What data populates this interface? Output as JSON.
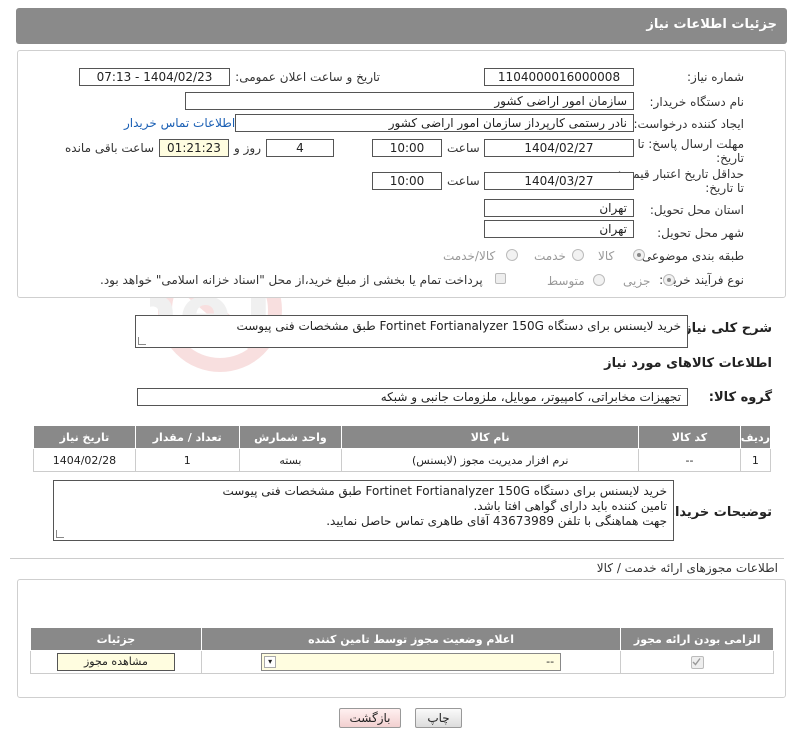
{
  "header": {
    "title": "جزئیات اطلاعات نیاز"
  },
  "form": {
    "need_number_label": "شماره نیاز:",
    "need_number": "1104000016000008",
    "announce_label": "تاریخ و ساعت اعلان عمومی:",
    "announce_value": "1404/02/23 - 07:13",
    "buyer_org_label": "نام دستگاه خریدار:",
    "buyer_org": "سازمان امور اراضی کشور",
    "creator_label": "ایجاد کننده درخواست:",
    "creator": "نادر رستمی کارپرداز سازمان امور اراضی کشور",
    "contact_link": "اطلاعات تماس خریدار",
    "deadline_label_1": "مهلت ارسال پاسخ: تا",
    "deadline_label_2": "تاریخ:",
    "deadline_date": "1404/02/27",
    "time_label": "ساعت",
    "deadline_time": "10:00",
    "days_value": "4",
    "days_label": "روز و",
    "remaining_time": "01:21:23",
    "remaining_label": "ساعت باقی مانده",
    "price_validity_label_1": "حداقل تاریخ اعتبار قیمت:",
    "price_validity_label_2": "تا تاریخ:",
    "price_validity_date": "1404/03/27",
    "price_validity_time": "10:00",
    "province_label": "استان محل تحویل:",
    "province": "تهران",
    "city_label": "شهر محل تحویل:",
    "city": "تهران",
    "category_label": "طبقه بندی موضوعی:",
    "category_options": [
      "کالا",
      "خدمت",
      "کالا/خدمت"
    ],
    "process_label": "نوع فرآیند خرید :",
    "process_options": [
      "جزیی",
      "متوسط"
    ],
    "payment_note": "پرداخت تمام یا بخشی از مبلغ خرید،از محل \"اسناد خزانه اسلامی\" خواهد بود."
  },
  "description": {
    "label": "شرح کلی نیاز:",
    "text": "خرید لایسنس برای دستگاه Fortinet Fortianalyzer 150G طبق مشخصات فنی پیوست"
  },
  "goods": {
    "section_title": "اطلاعات کالاهای مورد نیاز",
    "group_label": "گروه کالا:",
    "group_value": "تجهیزات مخابراتی، کامپیوتر، موبایل، ملزومات جانبی و شبکه",
    "columns": [
      "ردیف",
      "کد کالا",
      "نام کالا",
      "واحد شمارش",
      "تعداد / مقدار",
      "تاریخ نیاز"
    ],
    "rows": [
      [
        "1",
        "--",
        "نرم افزار مدیریت مجوز (لایسنس)",
        "بسته",
        "1",
        "1404/02/28"
      ]
    ]
  },
  "buyer_notes": {
    "label": "توضیحات خریدار:",
    "lines": [
      "خرید لایسنس برای دستگاه Fortinet Fortianalyzer 150G طبق مشخصات فنی پیوست",
      "تامین کننده باید دارای گواهی افتا باشد.",
      "جهت هماهنگی با تلفن 43673989 آقای طاهری تماس حاصل نمایید."
    ]
  },
  "permits": {
    "section_title": "اطلاعات مجوزهای ارائه خدمت / کالا",
    "columns": [
      "الزامی بودن ارائه مجوز",
      "اعلام وضعیت مجوز توسط تامین کننده",
      "جزئیات"
    ],
    "select_value": "--",
    "view_button": "مشاهده مجوز"
  },
  "actions": {
    "print": "چاپ",
    "back": "بازگشت"
  },
  "watermark": {
    "text": "AriaTender.neT"
  }
}
